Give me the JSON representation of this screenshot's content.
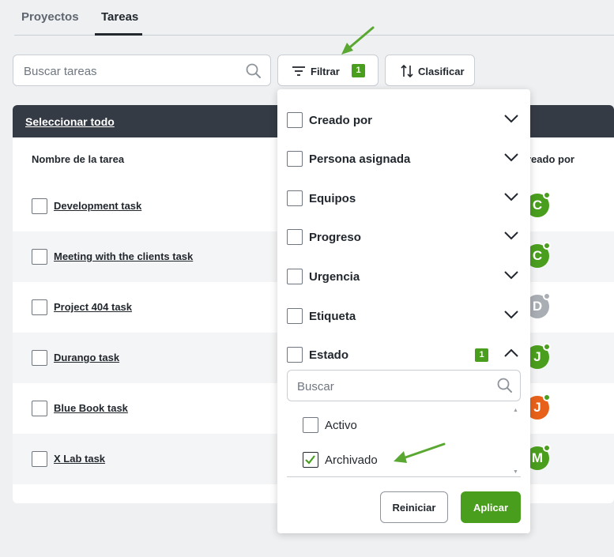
{
  "tabs": [
    {
      "label": "Proyectos",
      "active": false
    },
    {
      "label": "Tareas",
      "active": true
    }
  ],
  "toolbar": {
    "search_placeholder": "Buscar tareas",
    "filter_label": "Filtrar",
    "filter_count": "1",
    "sort_label": "Clasificar"
  },
  "table": {
    "select_all": "Seleccionar todo",
    "columns": {
      "name": "Nombre de la tarea",
      "created_by": "reado por"
    },
    "rows": [
      {
        "name": "Development task",
        "avatar": "C",
        "avatar_color": "#4a9e1e"
      },
      {
        "name": "Meeting with the clients task",
        "avatar": "C",
        "avatar_color": "#4a9e1e"
      },
      {
        "name": "Project 404 task",
        "avatar": "D",
        "avatar_color": "#a9aeb4"
      },
      {
        "name": "Durango task",
        "avatar": "J",
        "avatar_color": "#4a9e1e"
      },
      {
        "name": "Blue Book task",
        "avatar": "J",
        "avatar_color": "#e8611a"
      },
      {
        "name": "X Lab task",
        "avatar": "M",
        "avatar_color": "#4a9e1e"
      }
    ]
  },
  "filter_panel": {
    "filters": [
      {
        "label": "Creado por",
        "expanded": false
      },
      {
        "label": "Persona asignada",
        "expanded": false
      },
      {
        "label": "Equipos",
        "expanded": false
      },
      {
        "label": "Progreso",
        "expanded": false
      },
      {
        "label": "Urgencia",
        "expanded": false
      },
      {
        "label": "Etiqueta",
        "expanded": false
      },
      {
        "label": "Estado",
        "expanded": true,
        "count": "1"
      }
    ],
    "status_search_placeholder": "Buscar",
    "status_options": [
      {
        "label": "Activo",
        "checked": false
      },
      {
        "label": "Archivado",
        "checked": true
      }
    ],
    "reset_label": "Reiniciar",
    "apply_label": "Aplicar"
  },
  "colors": {
    "accent_green": "#4a9e1e",
    "header_dark": "#353b44",
    "annotation_arrow": "#5aa832"
  }
}
